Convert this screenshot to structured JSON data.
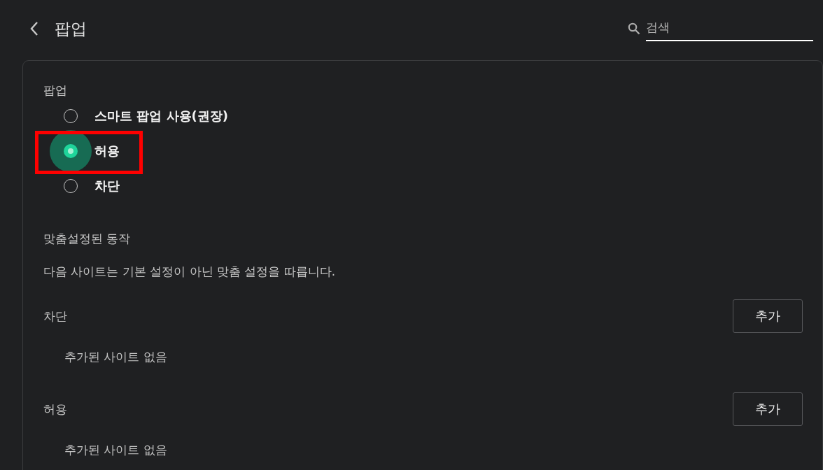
{
  "header": {
    "title": "팝업",
    "search": {
      "placeholder": "검색"
    }
  },
  "popup_section": {
    "label": "팝업",
    "options": [
      {
        "label": "스마트 팝업 사용(권장)",
        "selected": false,
        "focused": false,
        "highlighted": false
      },
      {
        "label": "허용",
        "selected": true,
        "focused": true,
        "highlighted": true
      },
      {
        "label": "차단",
        "selected": false,
        "focused": false,
        "highlighted": false
      }
    ]
  },
  "custom_section": {
    "title": "맞춤설정된 동작",
    "description": "다음 사이트는 기본 설정이 아닌 맞춤 설정을 따릅니다.",
    "lists": [
      {
        "label": "차단",
        "button": "추가",
        "empty_text": "추가된 사이트 없음"
      },
      {
        "label": "허용",
        "button": "추가",
        "empty_text": "추가된 사이트 없음"
      }
    ]
  }
}
